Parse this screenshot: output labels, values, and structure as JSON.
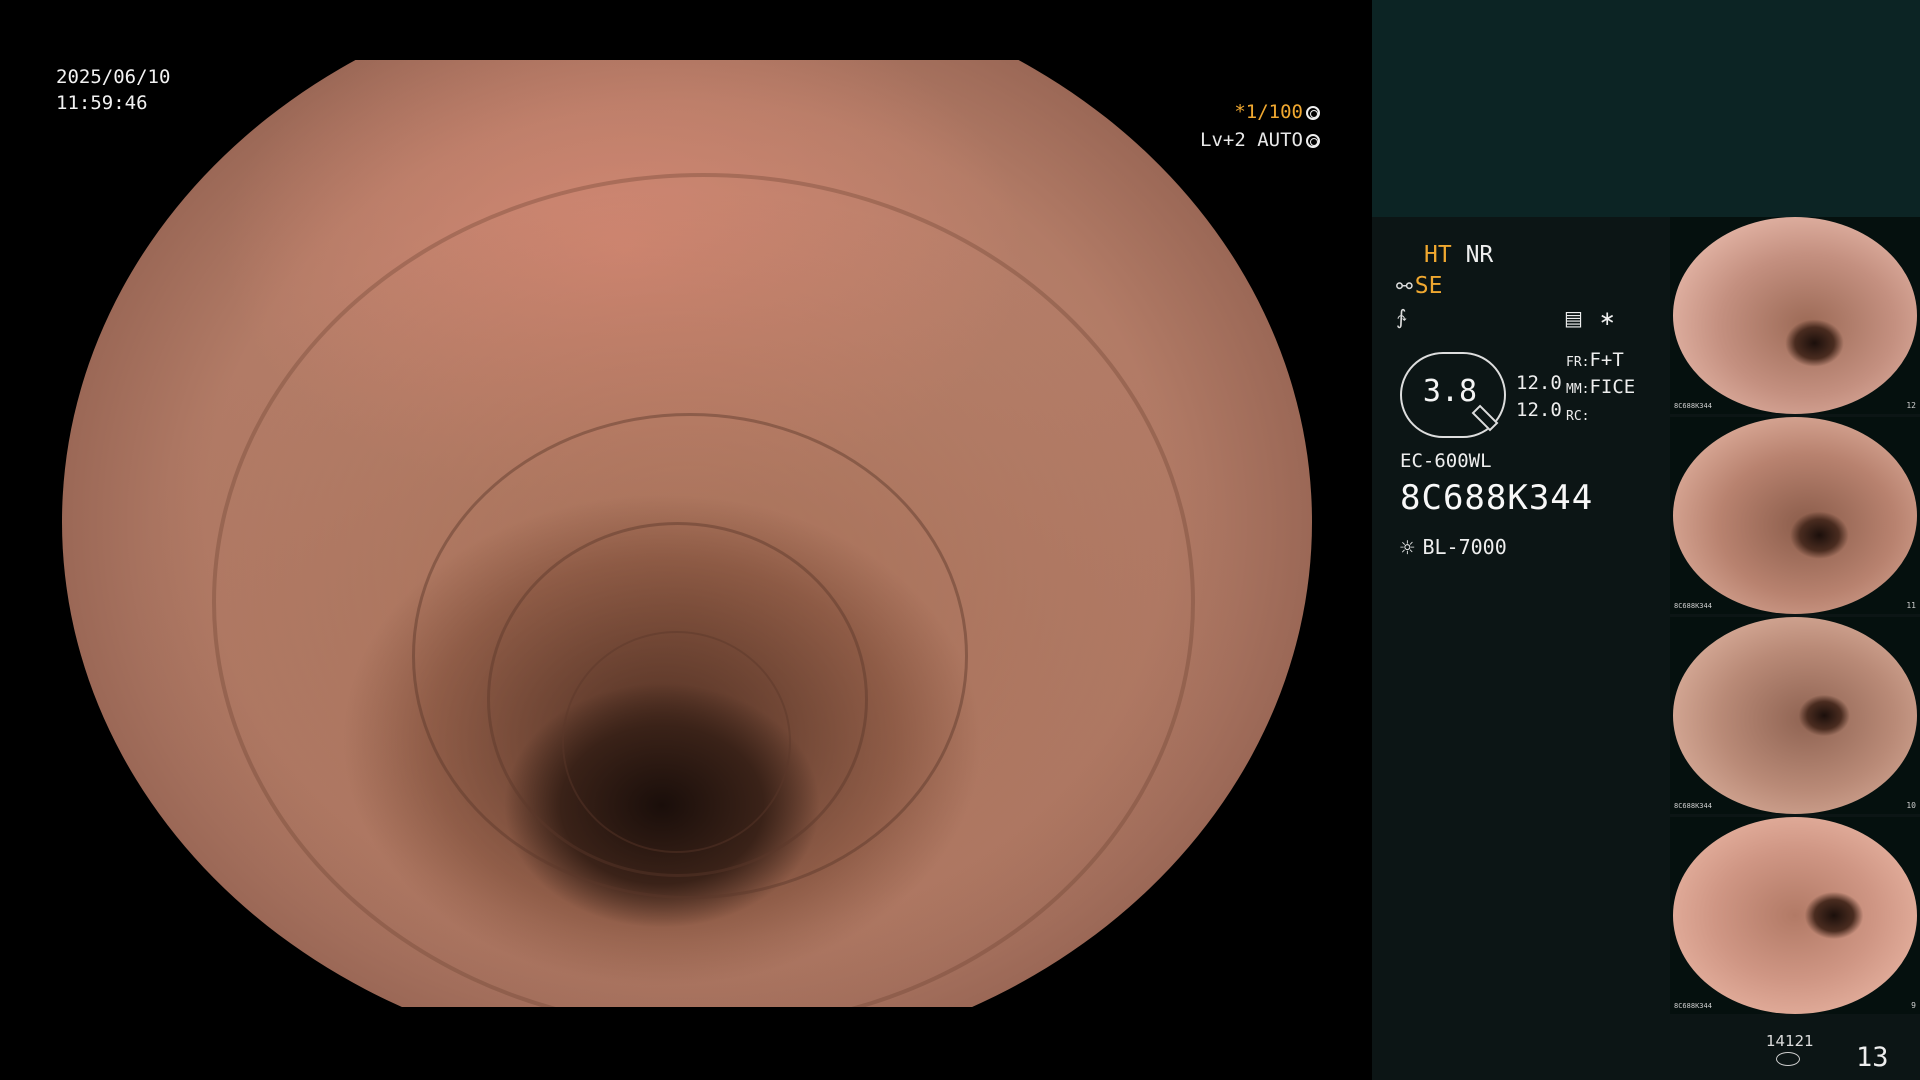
{
  "overlay": {
    "date": "2025/06/10",
    "time": "11:59:46",
    "shutter": "*1/100",
    "level": "Lv+2 AUTO"
  },
  "settings": {
    "ht": "HT",
    "nr": "NR",
    "se": "SE",
    "zoom": "3.8",
    "zoom_value_1": "12.0",
    "zoom_value_2": "12.0",
    "fr_label": "FR:",
    "fr_value": "F+T",
    "mm_label": "MM:",
    "mm_value": "FICE",
    "rc_label": "RC:",
    "scope_model": "EC-600WL",
    "serial": "8C688K344",
    "light_source": "BL-7000"
  },
  "thumbnails": [
    {
      "serial": "8C688K344",
      "number": "12"
    },
    {
      "serial": "8C688K344",
      "number": "11"
    },
    {
      "serial": "8C688K344",
      "number": "10"
    },
    {
      "serial": "8C688K344",
      "number": "9"
    }
  ],
  "footer": {
    "counter": "14121",
    "page": "13"
  },
  "colors": {
    "accent_amber": "#f0a830",
    "panel_bg": "#0c1515",
    "panel_header_bg": "#0c2424"
  }
}
